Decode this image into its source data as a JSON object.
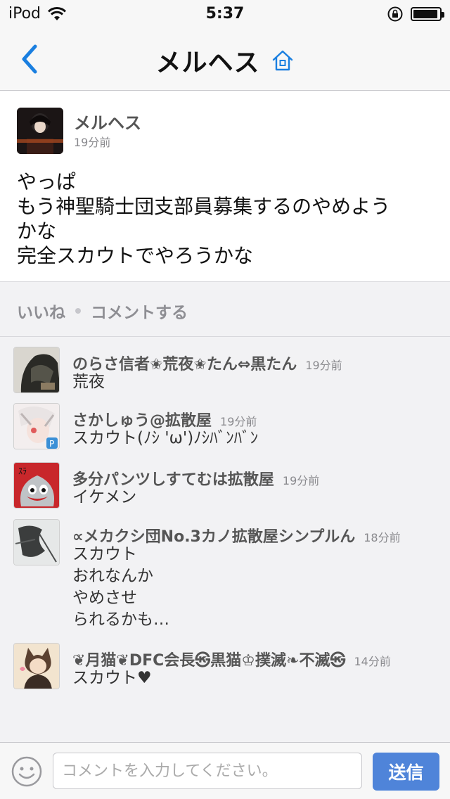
{
  "status_bar": {
    "device": "iPod",
    "time": "5:37",
    "wifi_icon": "wifi-icon",
    "rotation_lock_icon": "rotation-lock-icon",
    "battery_icon": "battery-icon"
  },
  "nav": {
    "back_icon": "chevron-left-icon",
    "title": "メルヘス",
    "home_icon": "home-icon",
    "accent_color": "#1a7fe0"
  },
  "post": {
    "author": "メルヘス",
    "time": "19分前",
    "body_lines": [
      "やっぱ",
      "もう神聖騎士団支部員募集するのやめよう",
      "かな",
      "完全スカウトでやろうかな"
    ]
  },
  "actions": {
    "like_label": "いいね",
    "comment_label": "コメントする"
  },
  "comments": [
    {
      "name": "のらさ信者✬荒夜✬たん⇔黒たん",
      "time": "19分前",
      "text_lines": [
        "荒夜"
      ]
    },
    {
      "name": "さかしゅう@拡散屋",
      "time": "19分前",
      "text_lines": [
        "スカウト(ﾉｼ 'ω')ﾉｼﾊﾞﾝﾊﾞﾝ"
      ]
    },
    {
      "name": "多分パンツしすてむは拡散屋",
      "time": "19分前",
      "text_lines": [
        "イケメン"
      ]
    },
    {
      "name": "∝メカクシ団No.3カノ拡散屋シンプルん",
      "time": "18分前",
      "text_lines": [
        "スカウト",
        "おれなんか",
        "やめさせ",
        "られるかも…"
      ]
    },
    {
      "name": "❦月猫❦DFC会長㉿黒猫♔撲滅❧不滅㉿",
      "time": "14分前",
      "text_lines": [
        "スカウト♥"
      ]
    }
  ],
  "input_bar": {
    "emoji_icon": "smiley-icon",
    "placeholder": "コメントを入力してください。",
    "send_label": "送信",
    "send_color": "#4f84d9"
  }
}
